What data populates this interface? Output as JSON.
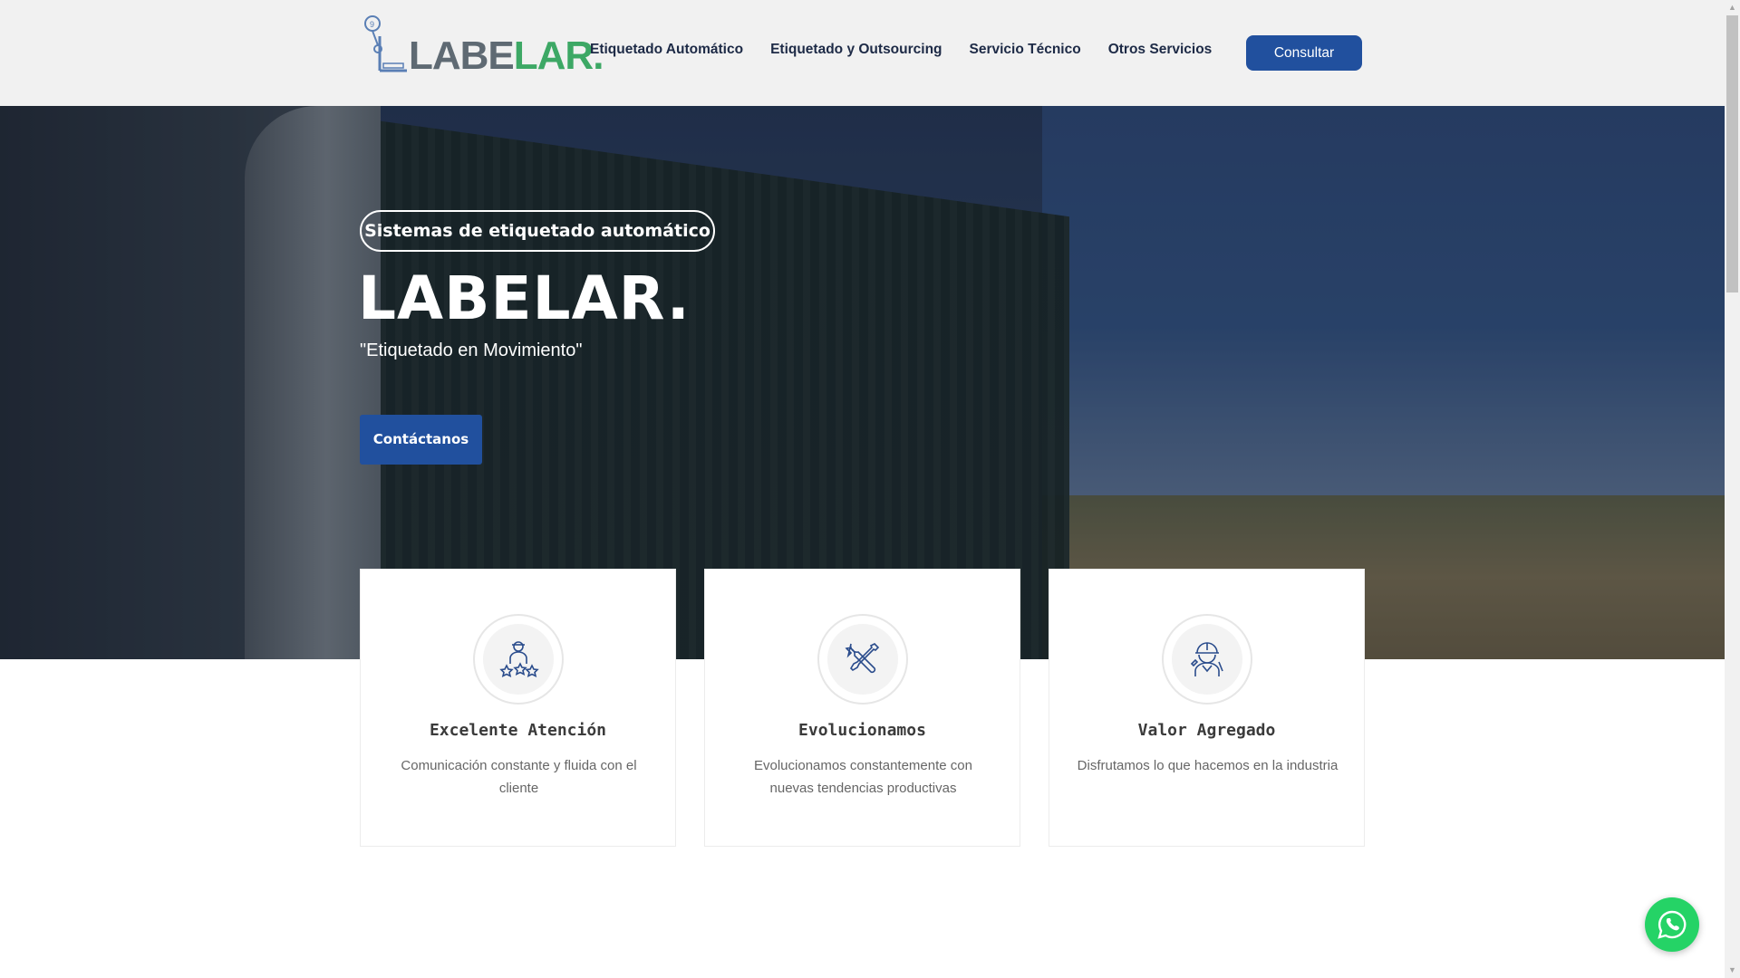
{
  "header": {
    "logo": {
      "text_prefix": "LABE",
      "text_suffix": "LAR.",
      "icon": "label-machine-icon"
    },
    "nav": [
      {
        "label": "Etiquetado Automático"
      },
      {
        "label": "Etiquetado y Outsourcing"
      },
      {
        "label": "Servicio Técnico"
      },
      {
        "label": "Otros Servicios"
      }
    ],
    "consult_label": "Consultar"
  },
  "hero": {
    "badge": "Sistemas de etiquetado automático",
    "title": "LABELAR.",
    "subtitle": "\"Etiquetado en Movimiento\"",
    "cta_label": "Contáctanos"
  },
  "features": [
    {
      "icon": "worker-stars-icon",
      "title": "Excelente Atención",
      "text": "Comunicación constante y fluida con el cliente"
    },
    {
      "icon": "wrench-screwdriver-icon",
      "title": "Evolucionamos",
      "text": "Evolucionamos constantemente con nuevas tendencias productivas"
    },
    {
      "icon": "engineer-helmet-icon",
      "title": "Valor Agregado",
      "text": "Disfrutamos lo que hacemos en la industria"
    }
  ],
  "colors": {
    "brand_blue": "#21509e",
    "logo_green": "#3da865",
    "logo_gray": "#5f6a73",
    "whatsapp_green": "#25d366"
  },
  "floating": {
    "whatsapp_icon": "whatsapp-icon"
  }
}
